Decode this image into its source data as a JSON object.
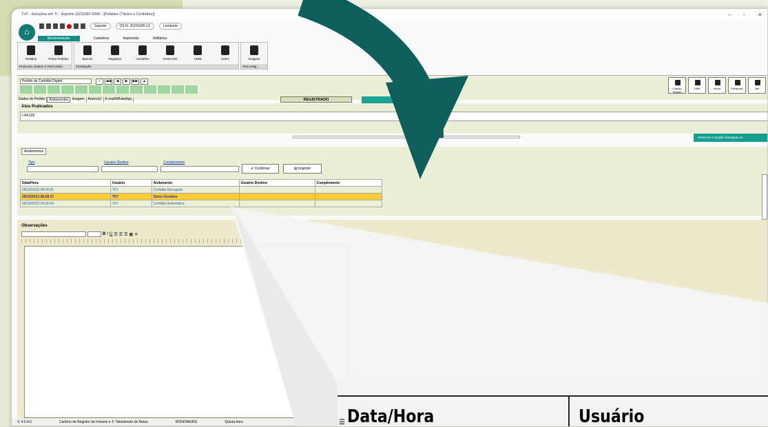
{
  "window": {
    "title": "TnT - Soluções em TI - Suporte (62)3280-3066 - [Pedidos (Títulos e Certidões)]"
  },
  "quickbar": {
    "support": "Suporte",
    "os": "OS N. 20231005-12",
    "reminder": "Lembrete"
  },
  "menu_tabs": [
    "Movimentação",
    "Cadastros",
    "Impressão",
    "Utilitários"
  ],
  "ribbon": {
    "groups": [
      {
        "label": "Protocolo, Exame e Ped.Certid..",
        "buttons": [
          "Pedidos",
          "Prazo Pedidos"
        ]
      },
      {
        "label": "Tramitação",
        "buttons": [
          "Buscas",
          "Registros",
          "Certidões",
          "Gerar DOI",
          "CNIB",
          "SAEC"
        ]
      },
      {
        "label": "Atos Antig...",
        "buttons": [
          "Imagens"
        ]
      }
    ]
  },
  "header": {
    "request_type": "Pedido de Certidão Digital"
  },
  "right_buttons": [
    "Cálculo Rápido",
    "ONR",
    "Incluir",
    "Pesquisar",
    "Sair"
  ],
  "page_tabs": [
    "Dados do Pedido",
    "Andamentos",
    "Imagem",
    "Anexo(s)",
    "E-mail/WhatsApp"
  ],
  "status_badge": "REGISTRADO",
  "atos": {
    "label": "Atos Praticados",
    "value": "I-44.526"
  },
  "select_option_bar": "Selecione a Opção Desejada Aci",
  "andamentos": {
    "tab": "Andamentos",
    "fields": {
      "tipo": "Tipo",
      "usuario_destino": "Usuário Destino",
      "complemento": "Complemento"
    },
    "confirm": "Confirmar",
    "print": "Imprimir",
    "columns": [
      "Data/Hora",
      "Usuário",
      "Andamento",
      "Usuário Destino",
      "Complemento"
    ],
    "rows": [
      {
        "data": "05/10/2023 08:28:26",
        "usuario": "TK7",
        "andamento": "Certidão Recepção",
        "destino": "",
        "complemento": ""
      },
      {
        "data": "05/10/2023 08:28:27",
        "usuario": "TK7",
        "andamento": "Selos Gerados",
        "destino": "",
        "complemento": ""
      },
      {
        "data": "05/10/2023 08:28:34",
        "usuario": "TK7",
        "andamento": "Certidão Automática",
        "destino": "",
        "complemento": ""
      }
    ]
  },
  "observacoes": {
    "label": "Observações"
  },
  "statusbar": {
    "version": "V. 4.0.4.0",
    "office": "Cartório de Registro de Imóveis e 1º Tabelionato de Notas",
    "city": "RONDINEIRU",
    "day": "Quinta-feira"
  },
  "zoom": {
    "col1": "Data/Hora",
    "col2": "Usuário"
  }
}
